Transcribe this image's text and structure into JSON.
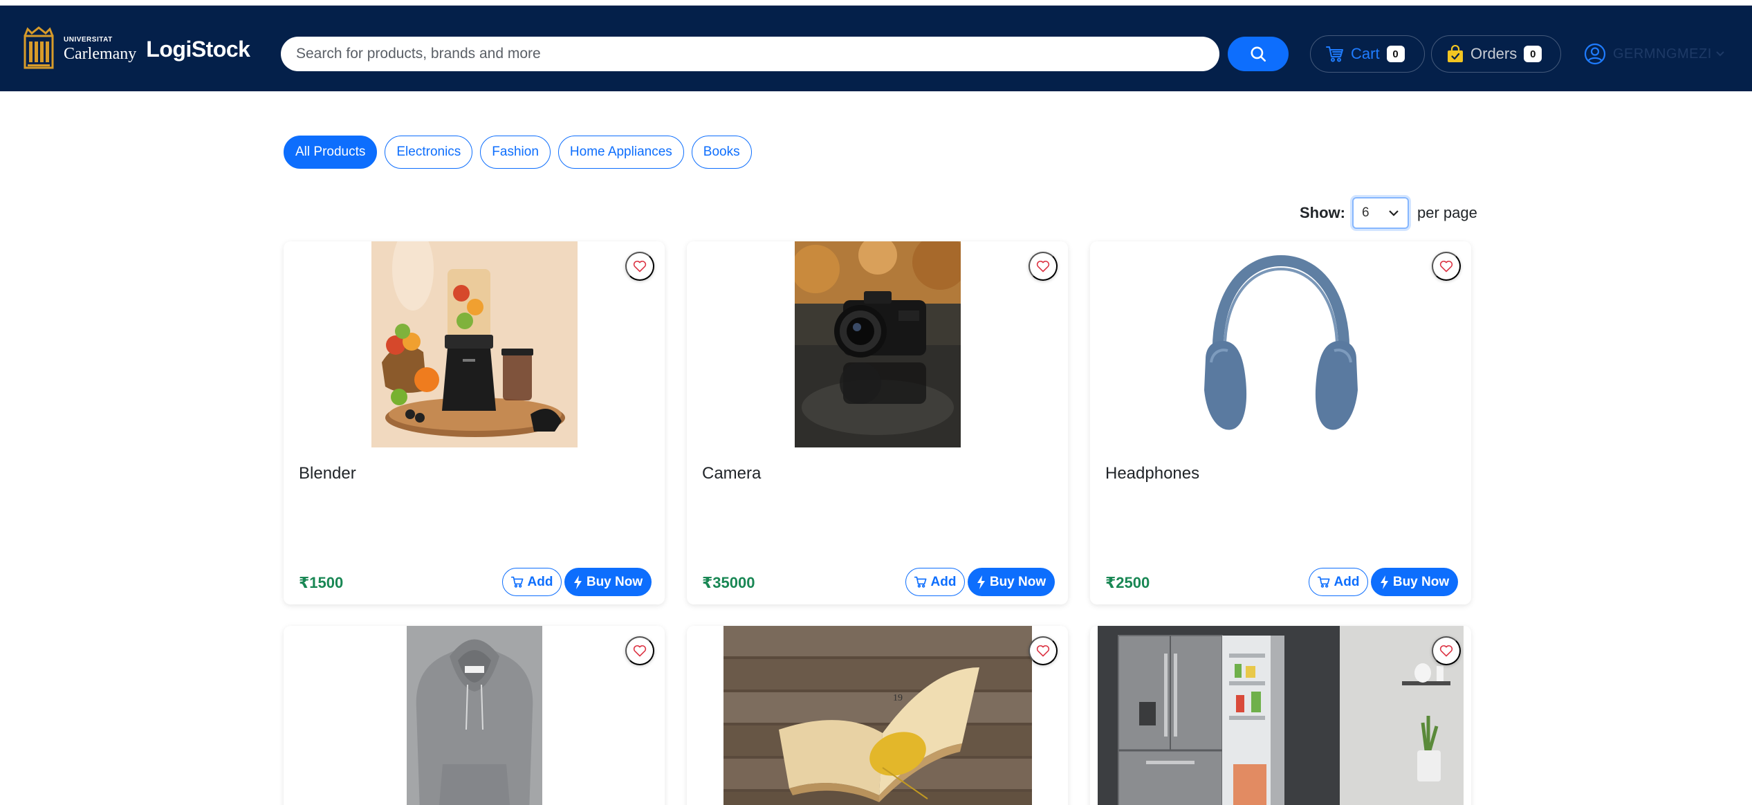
{
  "header": {
    "university_small": "UNIVERSITAT",
    "university_name": "Carlemany",
    "brand": "LogiStock",
    "search_placeholder": "Search for products, brands and more",
    "cart_label": "Cart",
    "cart_count": "0",
    "orders_label": "Orders",
    "orders_count": "0",
    "username": "GERMNGMEZI"
  },
  "categories": [
    {
      "label": "All Products",
      "active": true
    },
    {
      "label": "Electronics",
      "active": false
    },
    {
      "label": "Fashion",
      "active": false
    },
    {
      "label": "Home Appliances",
      "active": false
    },
    {
      "label": "Books",
      "active": false
    }
  ],
  "pagination": {
    "show_label": "Show:",
    "per_page_value": "6",
    "per_page_label": "per page"
  },
  "products": [
    {
      "name": "Blender",
      "price": "₹1500",
      "image": "blender-image"
    },
    {
      "name": "Camera",
      "price": "₹35000",
      "image": "camera-image"
    },
    {
      "name": "Headphones",
      "price": "₹2500",
      "image": "headphones-image"
    },
    {
      "name": "",
      "price": "",
      "image": "hoodie-image"
    },
    {
      "name": "",
      "price": "",
      "image": "book-image"
    },
    {
      "name": "",
      "price": "",
      "image": "refrigerator-image"
    }
  ],
  "buttons": {
    "add_label": "Add",
    "buy_label": "Buy Now"
  },
  "colors": {
    "navbar": "#04204a",
    "primary": "#0d6efd",
    "price": "#198754",
    "heart": "#dc3545"
  }
}
